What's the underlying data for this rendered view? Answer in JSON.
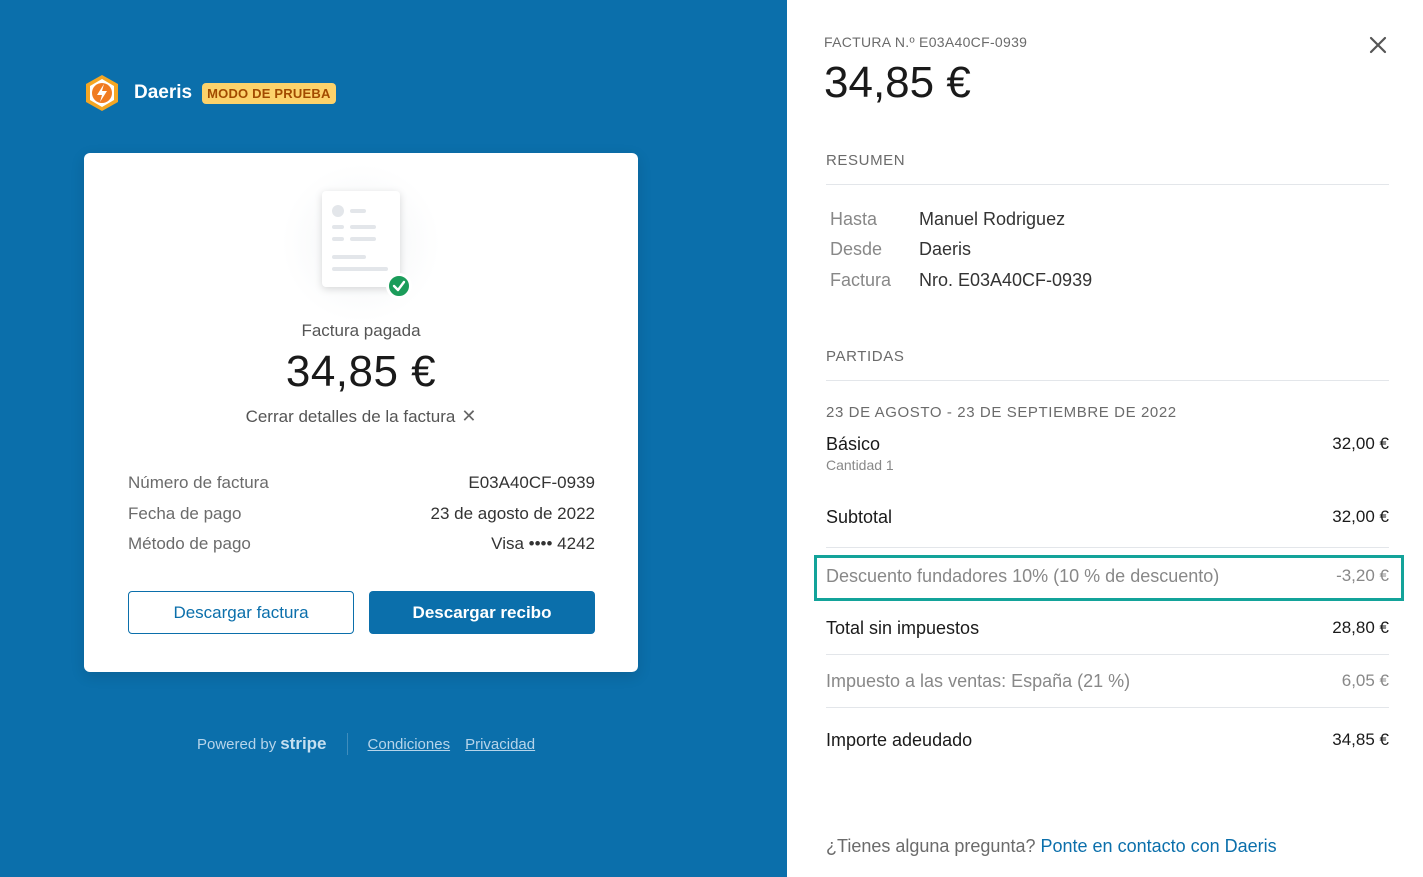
{
  "brand": {
    "name": "Daeris",
    "badge": "MODO DE PRUEBA"
  },
  "card": {
    "status": "Factura pagada",
    "amount": "34,85 €",
    "close_details": "Cerrar detalles de la factura",
    "rows": [
      {
        "label": "Número de factura",
        "value": "E03A40CF-0939"
      },
      {
        "label": "Fecha de pago",
        "value": "23 de agosto de 2022"
      },
      {
        "label": "Método de pago",
        "value": "Visa •••• 4242"
      }
    ],
    "download_invoice": "Descargar factura",
    "download_receipt": "Descargar recibo"
  },
  "footer": {
    "powered_by": "Powered by",
    "stripe": "stripe",
    "terms": "Condiciones",
    "privacy": "Privacidad"
  },
  "detail": {
    "invoice_number": "FACTURA N.º E03A40CF-0939",
    "total": "34,85 €",
    "summary_title": "RESUMEN",
    "summary": [
      {
        "label": "Hasta",
        "value": "Manuel Rodriguez"
      },
      {
        "label": "Desde",
        "value": "Daeris"
      },
      {
        "label": "Factura",
        "value": "Nro. E03A40CF-0939"
      }
    ],
    "items_title": "PARTIDAS",
    "period": "23 DE AGOSTO - 23 DE SEPTIEMBRE DE 2022",
    "item": {
      "name": "Básico",
      "qty": "Cantidad 1",
      "amount": "32,00 €"
    },
    "subtotal": {
      "label": "Subtotal",
      "value": "32,00 €"
    },
    "discount": {
      "label": "Descuento fundadores 10% (10 % de descuento)",
      "value": "-3,20 €"
    },
    "total_no_tax": {
      "label": "Total sin impuestos",
      "value": "28,80 €"
    },
    "tax": {
      "label": "Impuesto a las ventas: España (21 %)",
      "value": "6,05 €"
    },
    "amount_due": {
      "label": "Importe adeudado",
      "value": "34,85 €"
    },
    "question": "¿Tienes alguna pregunta?",
    "contact_link": "Ponte en contacto con Daeris"
  },
  "colors": {
    "brand_blue": "#0b6fab",
    "badge_bg": "#fcd26b",
    "success": "#1b9c5a",
    "highlight": "#13a39a"
  }
}
